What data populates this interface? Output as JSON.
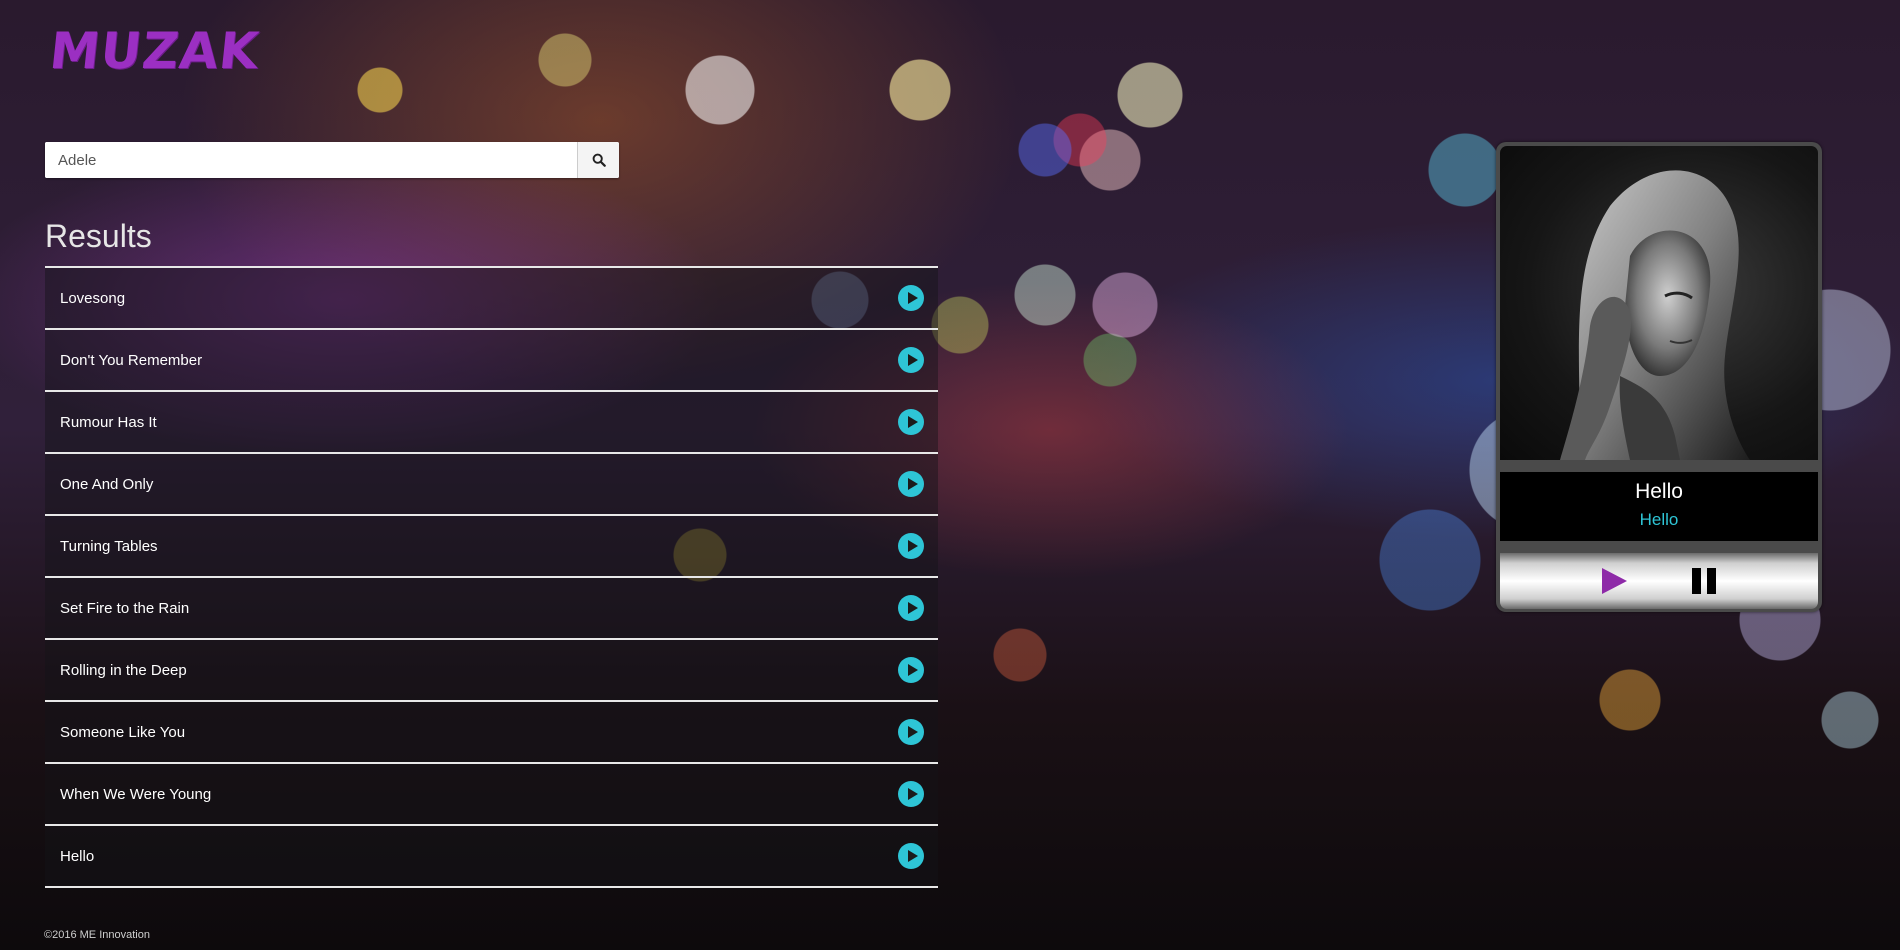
{
  "app": {
    "logo": "MUZAK"
  },
  "search": {
    "value": "Adele",
    "button_icon": "search-icon"
  },
  "results": {
    "heading": "Results",
    "items": [
      {
        "title": "Lovesong"
      },
      {
        "title": "Don't You Remember"
      },
      {
        "title": "Rumour Has It"
      },
      {
        "title": "One And Only"
      },
      {
        "title": "Turning Tables"
      },
      {
        "title": "Set Fire to the Rain"
      },
      {
        "title": "Rolling in the Deep"
      },
      {
        "title": "Someone Like You"
      },
      {
        "title": "When We Were Young"
      },
      {
        "title": "Hello"
      }
    ],
    "play_icon": "play-circle-icon"
  },
  "player": {
    "song": "Hello",
    "subtitle": "Hello",
    "controls": [
      "play-icon",
      "pause-icon"
    ]
  },
  "footer": {
    "text": "©2016 ME Innovation"
  },
  "colors": {
    "brand": "#9b2fc2",
    "accent": "#2ec5d6",
    "play": "#8e2aa8"
  }
}
